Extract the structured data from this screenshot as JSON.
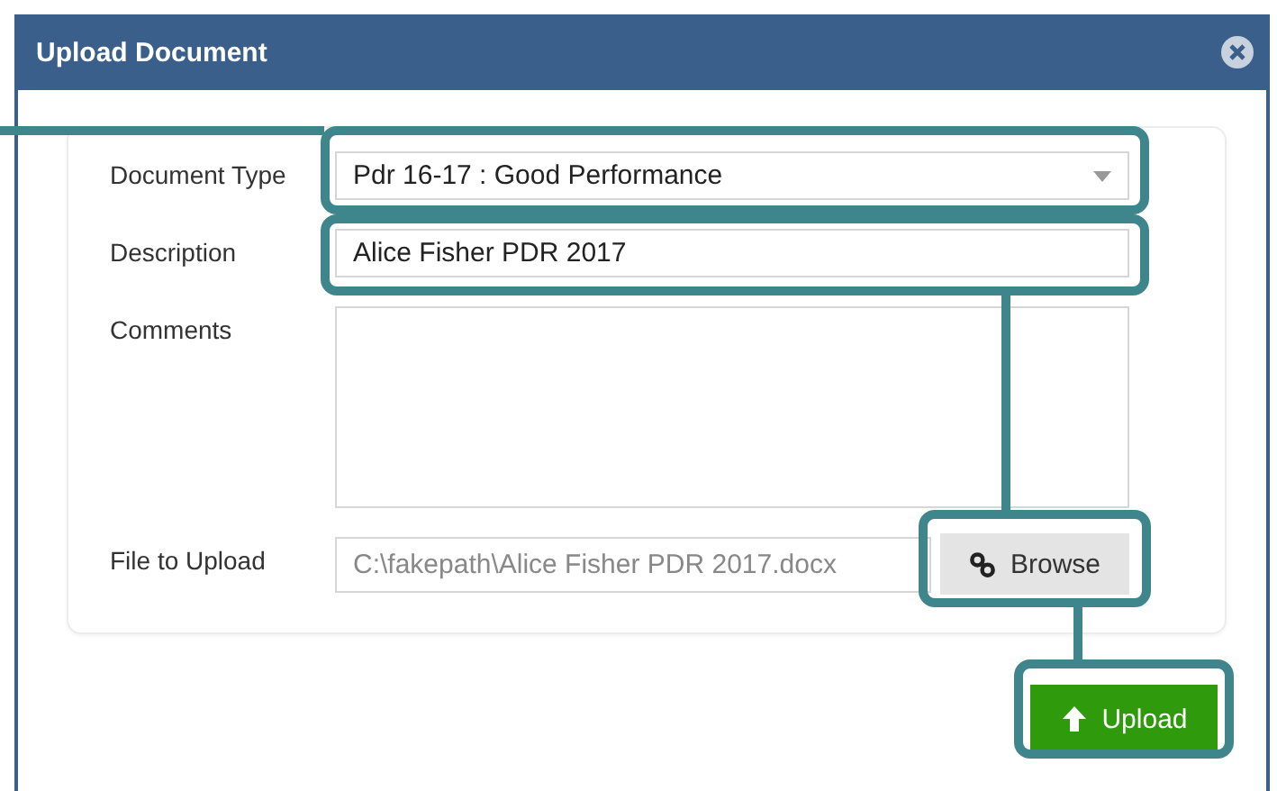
{
  "dialog": {
    "title": "Upload Document"
  },
  "fields": [
    {
      "kind": "select",
      "label": "Document Type",
      "value": "Pdr 16-17 : Good Performance"
    },
    {
      "kind": "text",
      "label": "Description",
      "value": "Alice Fisher PDR 2017"
    },
    {
      "kind": "textarea",
      "label": "Comments"
    },
    {
      "kind": "file",
      "label": "File to Upload",
      "value": "C:\\fakepath\\Alice Fisher PDR 2017.docx",
      "button": "Browse"
    }
  ],
  "upload_button": "Upload"
}
